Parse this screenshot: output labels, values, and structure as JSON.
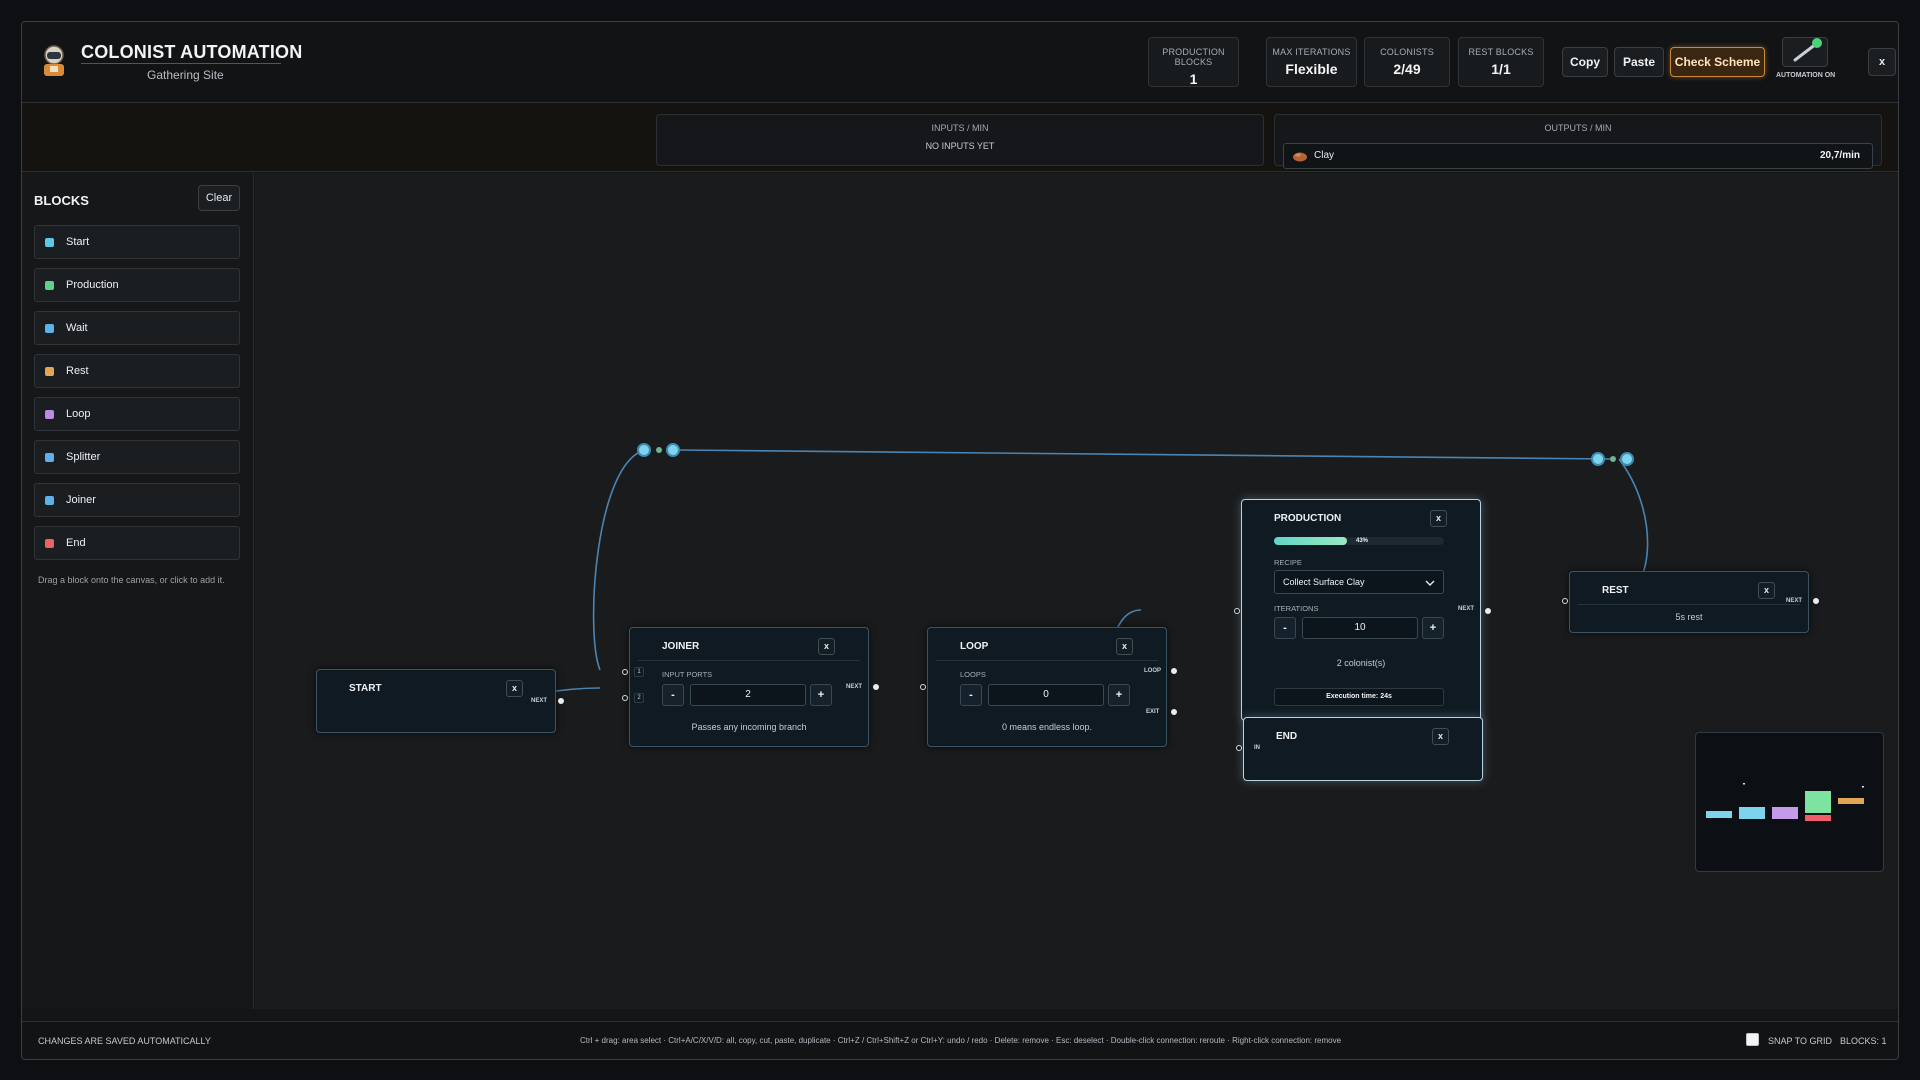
{
  "header": {
    "title": "COLONIST AUTOMATION",
    "subtitle": "Gathering Site",
    "stats": [
      {
        "label": "PRODUCTION BLOCKS",
        "value": "1"
      },
      {
        "label": "MAX ITERATIONS",
        "value": "Flexible"
      },
      {
        "label": "COLONISTS",
        "value": "2/49"
      },
      {
        "label": "REST BLOCKS",
        "value": "1/1"
      }
    ],
    "copy_label": "Copy",
    "paste_label": "Paste",
    "check_label": "Check Scheme",
    "automation_label": "AUTOMATION ON",
    "close_label": "x"
  },
  "io": {
    "inputs_title": "INPUTS / MIN",
    "inputs_empty": "NO INPUTS YET",
    "outputs_title": "OUTPUTS / MIN",
    "outputs": [
      {
        "name": "Clay",
        "rate": "20,7/min"
      }
    ]
  },
  "sidebar": {
    "title": "BLOCKS",
    "clear_label": "Clear",
    "items": [
      {
        "label": "Start",
        "color": "#5ec8e8"
      },
      {
        "label": "Production",
        "color": "#5fd08a"
      },
      {
        "label": "Wait",
        "color": "#5fb0e8"
      },
      {
        "label": "Rest",
        "color": "#e0a654"
      },
      {
        "label": "Loop",
        "color": "#b98ae6"
      },
      {
        "label": "Splitter",
        "color": "#5fb0e8"
      },
      {
        "label": "Joiner",
        "color": "#5fb0e8"
      },
      {
        "label": "End",
        "color": "#e86464"
      }
    ],
    "hint": "Drag a block onto the canvas, or click to add it."
  },
  "nodes": {
    "start": {
      "title": "START",
      "close": "x",
      "next": "NEXT"
    },
    "joiner": {
      "title": "JOINER",
      "close": "x",
      "field": "INPUT PORTS",
      "minus": "-",
      "value": "2",
      "plus": "+",
      "hint": "Passes any incoming branch",
      "next": "NEXT",
      "port1": "1",
      "port2": "2"
    },
    "loop": {
      "title": "LOOP",
      "close": "x",
      "field": "LOOPS",
      "minus": "-",
      "value": "0",
      "plus": "+",
      "hint": "0 means endless loop.",
      "loop": "LOOP",
      "exit": "EXIT"
    },
    "production": {
      "title": "PRODUCTION",
      "close": "x",
      "progress": 0.43,
      "progress_label": "43%",
      "recipe_label": "RECIPE",
      "recipe": "Collect Surface Clay",
      "iterations_label": "ITERATIONS",
      "minus": "-",
      "iterations": "10",
      "plus": "+",
      "colonists": "2 colonist(s)",
      "execution": "Execution time: 24s",
      "next": "NEXT"
    },
    "rest": {
      "title": "REST",
      "close": "x",
      "hint": "5s rest",
      "next": "NEXT"
    },
    "end": {
      "title": "END",
      "close": "x",
      "in": "IN"
    }
  },
  "footer": {
    "left": "CHANGES ARE SAVED AUTOMATICALLY",
    "shortcuts": "Ctrl + drag: area select · Ctrl+A/C/X/V/D: all, copy, cut, paste, duplicate · Ctrl+Z / Ctrl+Shift+Z or Ctrl+Y: undo / redo · Delete: remove · Esc: deselect · Double-click connection: reroute · Right-click connection: remove",
    "snap_label": "SNAP TO GRID",
    "blocks_label": "BLOCKS: 1"
  }
}
